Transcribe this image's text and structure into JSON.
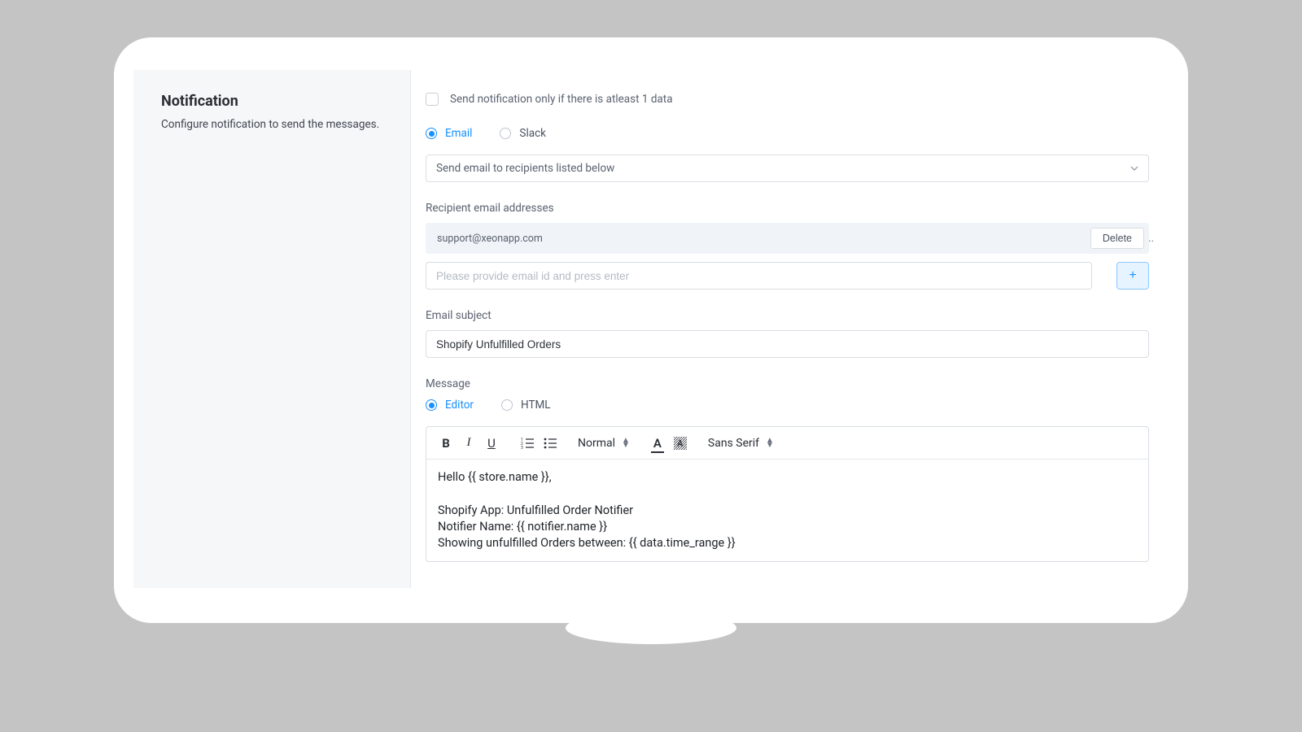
{
  "sidebar": {
    "title": "Notification",
    "subtitle": "Configure notification to send the messages."
  },
  "condition_checkbox_label": "Send notification only if there is atleast 1 data",
  "channel": {
    "email_label": "Email",
    "slack_label": "Slack"
  },
  "send_mode_selected": "Send email to recipients listed below",
  "recipients_label": "Recipient email addresses",
  "recipients": [
    {
      "email": "support@xeonapp.com",
      "delete_label": "Delete"
    }
  ],
  "email_input_placeholder": "Please provide email id and press enter",
  "add_button_label": "+",
  "subject_label": "Email subject",
  "subject_value": "Shopify Unfulfilled Orders",
  "message_label": "Message",
  "message_mode": {
    "editor_label": "Editor",
    "html_label": "HTML"
  },
  "toolbar": {
    "paragraph": "Normal",
    "font": "Sans Serif"
  },
  "editor_content": "Hello {{ store.name }},\n\nShopify App: Unfulfilled Order Notifier\nNotifier Name: {{ notifier.name }}\nShowing unfulfilled Orders between: {{ data.time_range }}"
}
